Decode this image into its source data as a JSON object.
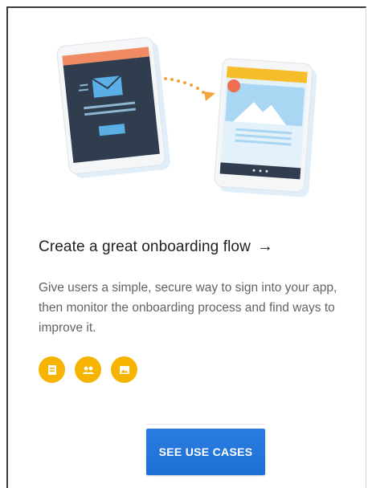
{
  "card": {
    "title": "Create a great onboarding flow",
    "title_arrow": "→",
    "description": "Give users a simple, secure way to sign into your app, then monitor the onboarding process and find ways to improve it.",
    "product_icons": [
      "auth-product-icon",
      "users-product-icon",
      "media-product-icon"
    ],
    "cta_label": "SEE USE CASES"
  },
  "colors": {
    "accent": "#f6b400",
    "button": "#1c6fd4",
    "phone_left_header": "#ef8a63",
    "phone_right_header": "#f6bd2a",
    "phone_body": "#2f3d4f",
    "arrow_dots": "#f2a33a"
  }
}
